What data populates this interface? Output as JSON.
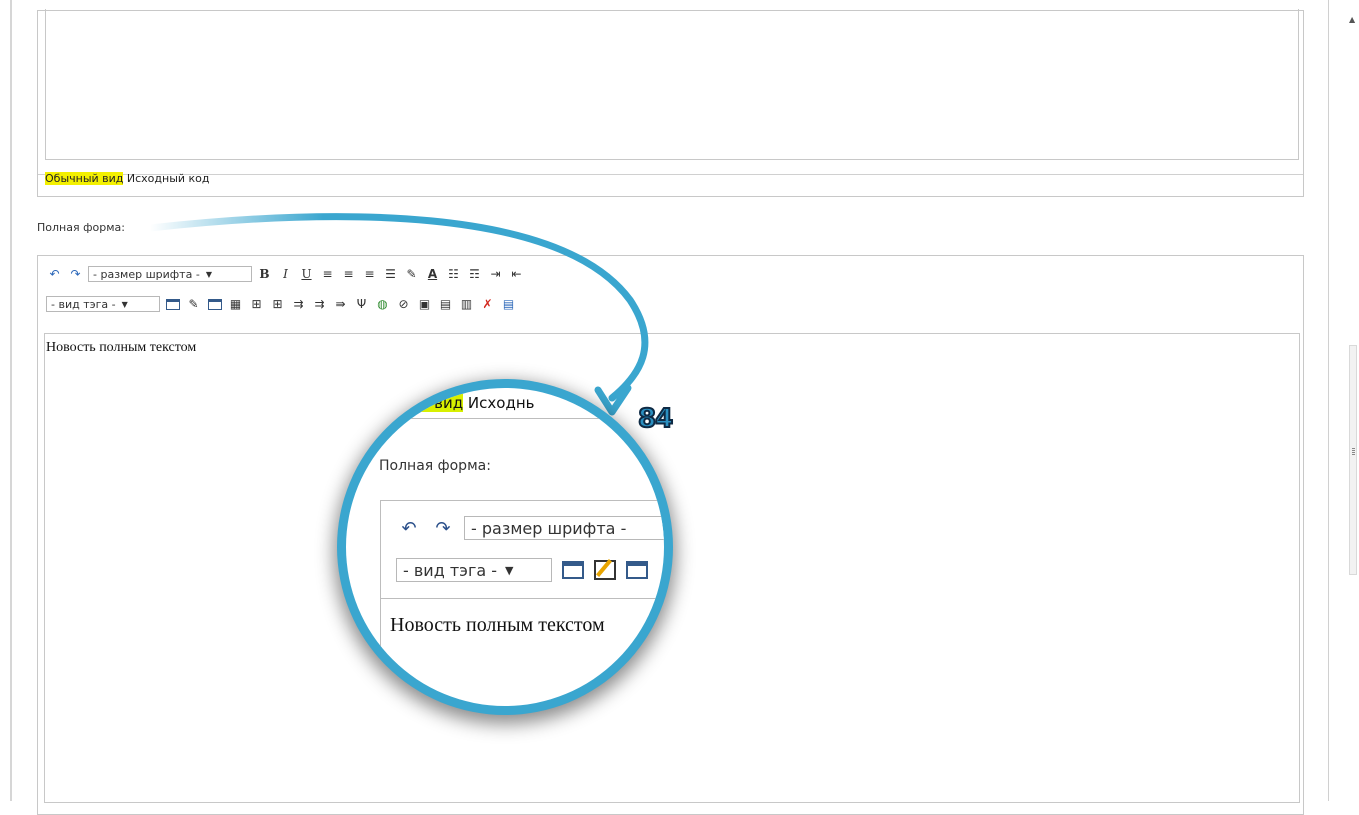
{
  "top_editor": {
    "mode_tabs": [
      {
        "label": "Обычный вид",
        "active": true
      },
      {
        "label": "Исходный код",
        "active": false
      }
    ]
  },
  "full_form": {
    "label": "Полная форма:",
    "toolbar": {
      "font_size_select": "- размер шрифта -",
      "tag_select": "- вид тэга -"
    },
    "editor_text": "Новость полным текстом"
  },
  "magnifier": {
    "mode_active": "ный вид",
    "mode_other": "Исходнь",
    "full_label": "Полная форма:",
    "font_size_select": "- размер шрифта -",
    "tag_select": "- вид тэга -",
    "editor_text": "Новость полным текстом"
  },
  "step_number": "84",
  "colors": {
    "highlight": "#f3f000",
    "callout_blue": "#3aa6cf",
    "border": "#c8c8c8"
  }
}
